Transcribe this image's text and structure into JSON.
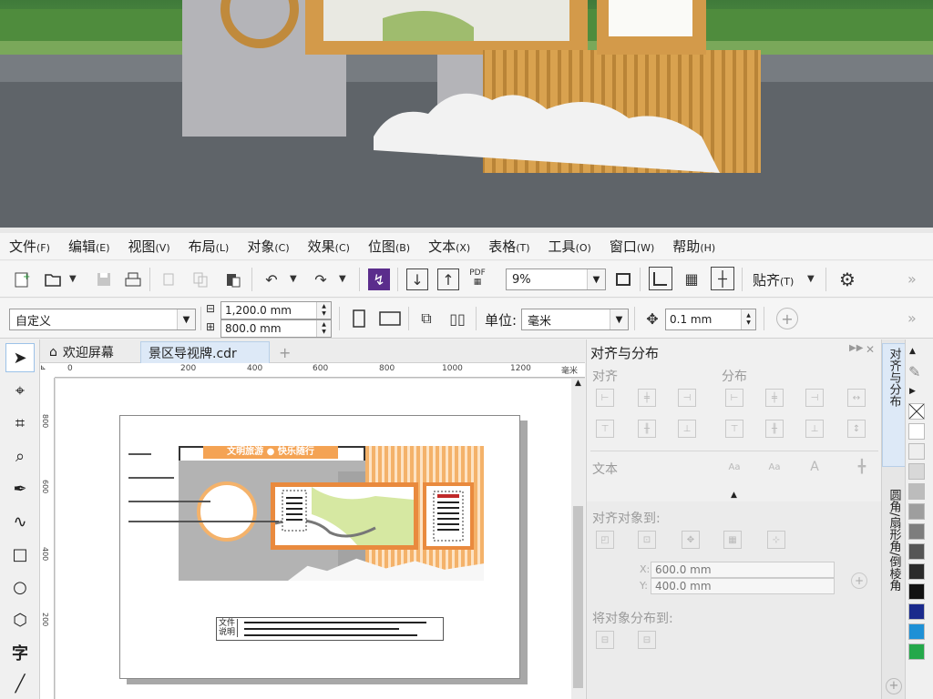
{
  "menu": [
    {
      "label": "文件",
      "key": "(F)"
    },
    {
      "label": "编辑",
      "key": "(E)"
    },
    {
      "label": "视图",
      "key": "(V)"
    },
    {
      "label": "布局",
      "key": "(L)"
    },
    {
      "label": "对象",
      "key": "(C)"
    },
    {
      "label": "效果",
      "key": "(C)"
    },
    {
      "label": "位图",
      "key": "(B)"
    },
    {
      "label": "文本",
      "key": "(X)"
    },
    {
      "label": "表格",
      "key": "(T)"
    },
    {
      "label": "工具",
      "key": "(O)"
    },
    {
      "label": "窗口",
      "key": "(W)"
    },
    {
      "label": "帮助",
      "key": "(H)"
    }
  ],
  "toolbar": {
    "pdf_label": "PDF",
    "zoom_value": "9%",
    "snap_label": "贴齐",
    "snap_key": "(T)",
    "more": "»"
  },
  "property_bar": {
    "page_preset": "自定义",
    "width": "1,200.0 mm",
    "height": "800.0 mm",
    "units_label": "单位:",
    "units_value": "毫米",
    "nudge": "0.1 mm",
    "more": "»"
  },
  "tabs": [
    {
      "label": "欢迎屏幕"
    },
    {
      "label": "景区导视牌.cdr"
    }
  ],
  "new_tab": "+",
  "ruler": {
    "h_ticks": [
      "0",
      "200",
      "400",
      "600",
      "800",
      "1000",
      "1200"
    ],
    "h_unit": "毫米",
    "v_ticks": [
      "800",
      "600",
      "400",
      "200"
    ]
  },
  "design": {
    "banner_text": "文明旅游 ● 快乐随行",
    "note_label_1": "文件",
    "note_label_2": "说明"
  },
  "panel": {
    "title": "对齐与分布",
    "align_label": "对齐",
    "distribute_label": "分布",
    "text_label": "文本",
    "align_to_label": "对齐对象到:",
    "x_label": "X:",
    "x_value": "600.0 mm",
    "y_label": "Y:",
    "y_value": "400.0 mm",
    "distribute_to_label": "将对象分布到:"
  },
  "side_tabs": [
    {
      "label": "对齐与分布"
    },
    {
      "label": "圆角/扇形角/倒棱角"
    }
  ],
  "colors": {
    "accent_orange": "#e0762a",
    "light_orange": "#f4b26a",
    "sign_gray": "#a8a8a8",
    "selection_blue": "#dde9f7"
  },
  "palette": [
    "#ffffff",
    "#eeeeee",
    "#d8d8d8",
    "#bcbcbc",
    "#9e9e9e",
    "#7d7d7d",
    "#555555",
    "#2a2a2a",
    "#111111",
    "#1a2a8c",
    "#1e90d6",
    "#24a84a"
  ]
}
